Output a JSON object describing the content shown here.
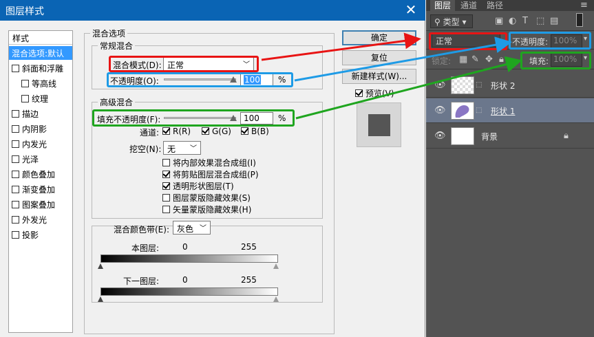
{
  "dialog": {
    "title": "图层样式",
    "close_glyph": "✕",
    "styles_header": "样式",
    "styles": [
      {
        "label": "混合选项:默认",
        "checkbox": false,
        "selected": true
      },
      {
        "label": "斜面和浮雕",
        "checkbox": true,
        "checked": false
      },
      {
        "label": "等高线",
        "checkbox": true,
        "checked": false
      },
      {
        "label": "纹理",
        "checkbox": true,
        "checked": false
      },
      {
        "label": "描边",
        "checkbox": true,
        "checked": false
      },
      {
        "label": "内阴影",
        "checkbox": true,
        "checked": false
      },
      {
        "label": "内发光",
        "checkbox": true,
        "checked": false
      },
      {
        "label": "光泽",
        "checkbox": true,
        "checked": false
      },
      {
        "label": "颜色叠加",
        "checkbox": true,
        "checked": false
      },
      {
        "label": "渐变叠加",
        "checkbox": true,
        "checked": false
      },
      {
        "label": "图案叠加",
        "checkbox": true,
        "checked": false
      },
      {
        "label": "外发光",
        "checkbox": true,
        "checked": false
      },
      {
        "label": "投影",
        "checkbox": true,
        "checked": false
      }
    ],
    "blend_options_legend": "混合选项",
    "general_legend": "常规混合",
    "blend_mode_label": "混合模式(D):",
    "blend_mode_value": "正常",
    "opacity_label": "不透明度(O):",
    "opacity_value": "100",
    "opacity_unit": "%",
    "advanced_legend": "高级混合",
    "fill_opacity_label": "填充不透明度(F):",
    "fill_opacity_value": "100",
    "fill_opacity_unit": "%",
    "channels_label": "通道:",
    "channel_r": "R(R)",
    "channel_g": "G(G)",
    "channel_b": "B(B)",
    "knockout_label": "挖空(N):",
    "knockout_value": "无",
    "adv_options": [
      {
        "label": "将内部效果混合成组(I)",
        "checked": false
      },
      {
        "label": "将剪贴图层混合成组(P)",
        "checked": true
      },
      {
        "label": "透明形状图层(T)",
        "checked": true
      },
      {
        "label": "图层蒙版隐藏效果(S)",
        "checked": false
      },
      {
        "label": "矢量蒙版隐藏效果(H)",
        "checked": false
      }
    ],
    "blend_if_label": "混合颜色带(E):",
    "blend_if_value": "灰色",
    "this_layer_label": "本图层:",
    "this_layer_low": "0",
    "this_layer_high": "255",
    "underlying_label": "下一图层:",
    "underlying_low": "0",
    "underlying_high": "255",
    "ok_label": "确定",
    "reset_label": "复位",
    "new_style_label": "新建样式(W)...",
    "preview_label": "预览(V)",
    "preview_checked": true
  },
  "panel": {
    "tabs": [
      "图层",
      "通道",
      "路径"
    ],
    "active_tab": 0,
    "filter_label": "类型",
    "blend_mode_value": "正常",
    "opacity_label": "不透明度:",
    "opacity_value": "100%",
    "lock_label": "锁定:",
    "fill_label": "填充:",
    "fill_value": "100%",
    "layers": [
      {
        "name": "形状 2",
        "selected": false,
        "thumb": "shape-white"
      },
      {
        "name": "形状 1",
        "selected": true,
        "thumb": "shape-purple"
      },
      {
        "name": "背景",
        "selected": false,
        "thumb": "white",
        "locked": true
      }
    ]
  },
  "colors": {
    "red": "#e81414",
    "blue": "#1e9be6",
    "green": "#1fa51f",
    "titlebar": "#0a64b4",
    "selection": "#3399ff",
    "shape_purple": "#8a76c4"
  }
}
